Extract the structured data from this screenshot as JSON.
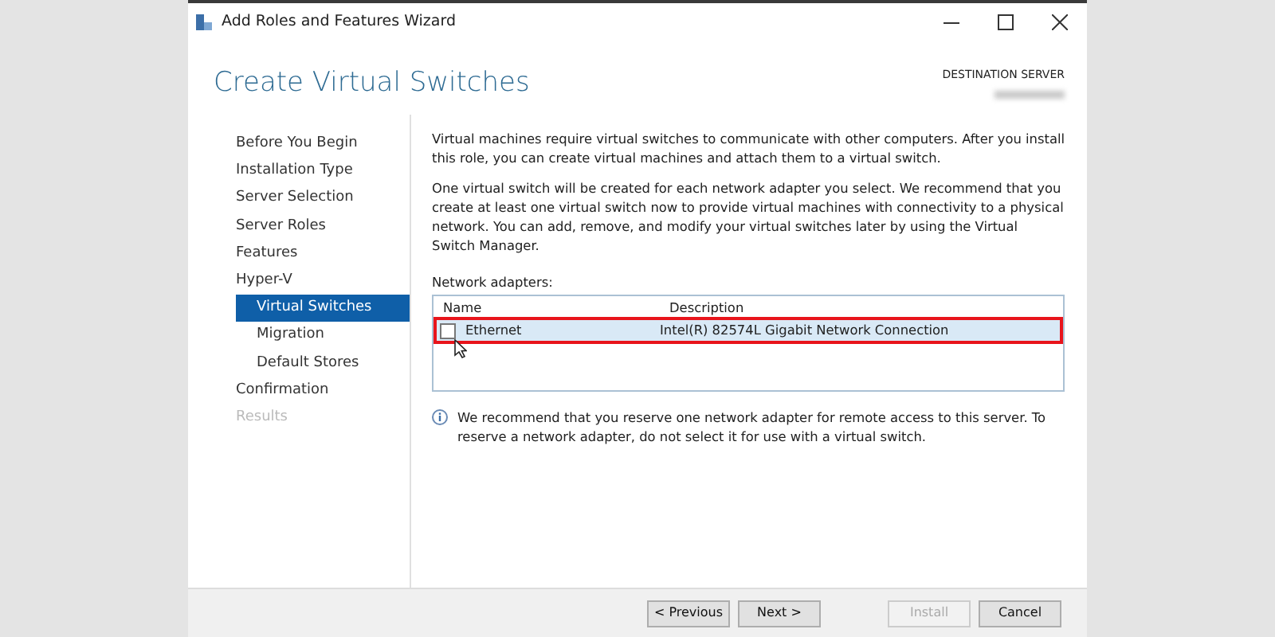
{
  "window": {
    "title": "Add Roles and Features Wizard"
  },
  "header": {
    "title": "Create Virtual Switches",
    "destination_label": "DESTINATION SERVER"
  },
  "nav": [
    {
      "label": "Before You Begin",
      "selected": false,
      "disabled": false
    },
    {
      "label": "Installation Type",
      "selected": false,
      "disabled": false
    },
    {
      "label": "Server Selection",
      "selected": false,
      "disabled": false
    },
    {
      "label": "Server Roles",
      "selected": false,
      "disabled": false
    },
    {
      "label": "Features",
      "selected": false,
      "disabled": false
    },
    {
      "label": "Hyper-V",
      "selected": false,
      "disabled": false,
      "children": [
        {
          "label": "Virtual Switches",
          "selected": true,
          "disabled": false
        },
        {
          "label": "Migration",
          "selected": false,
          "disabled": false
        },
        {
          "label": "Default Stores",
          "selected": false,
          "disabled": false
        }
      ]
    },
    {
      "label": "Confirmation",
      "selected": false,
      "disabled": false
    },
    {
      "label": "Results",
      "selected": false,
      "disabled": true
    }
  ],
  "paragraphs": [
    "Virtual machines require virtual switches to communicate with other computers. After you install this role, you can create virtual machines and attach them to a virtual switch.",
    "One virtual switch will be created for each network adapter you select. We recommend that you create at least one virtual switch now to provide virtual machines with connectivity to a physical network. You can add, remove, and modify your virtual switches later by using the Virtual Switch Manager."
  ],
  "adapters": {
    "label": "Network adapters:",
    "columns": [
      "Name",
      "Description"
    ],
    "rows": [
      {
        "name": "Ethernet",
        "description": "Intel(R) 82574L Gigabit Network Connection",
        "checked": false,
        "selected": true,
        "highlighted": true
      }
    ]
  },
  "info": "We recommend that you reserve one network adapter for remote access to this server. To reserve a network adapter, do not select it for use with a virtual switch.",
  "buttons": [
    {
      "label": "< Previous",
      "disabled": false
    },
    {
      "label": "Next >",
      "disabled": false
    },
    {
      "label": "Install",
      "disabled": true
    },
    {
      "label": "Cancel",
      "disabled": false
    }
  ]
}
